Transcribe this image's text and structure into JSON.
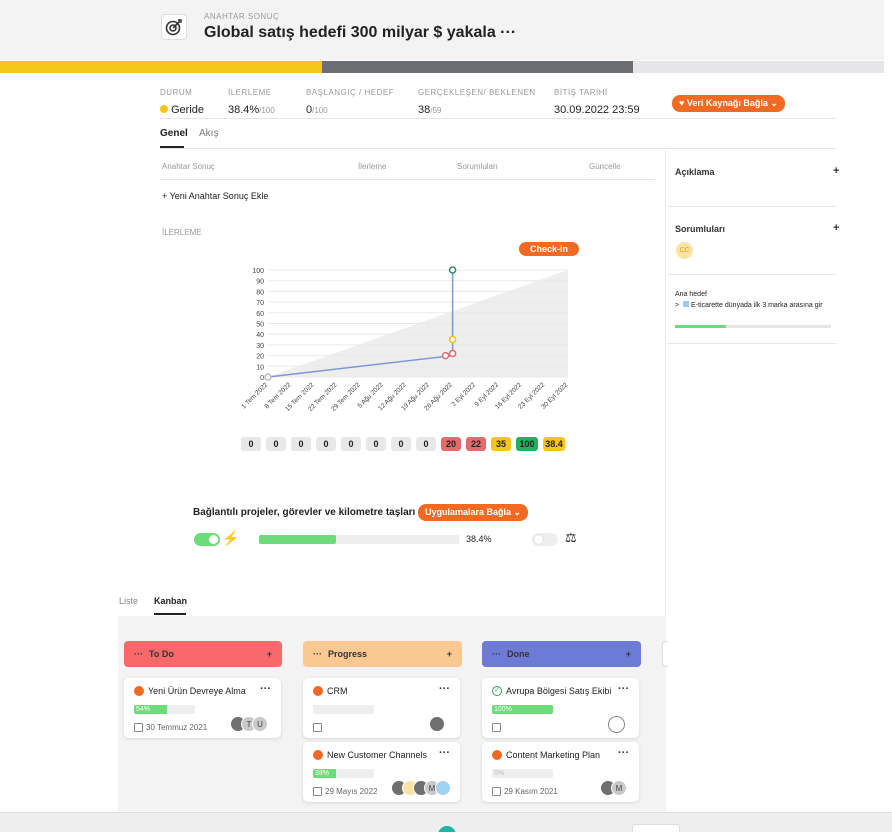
{
  "header": {
    "label": "ANAHTAR SONUÇ",
    "title": "Global satış hedefi 300 milyar $ yakala ···"
  },
  "progress_strip": {
    "colors": [
      "#f5c518",
      "#6b6e75",
      "#e6e6e8"
    ]
  },
  "meta": {
    "durum_label": "DURUM",
    "durum_value": "Geride",
    "ilerleme_label": "İLERLEME",
    "ilerleme_value": "38.4%",
    "ilerleme_total": "/100",
    "baslangic_label": "BAŞLANGIÇ / HEDEF",
    "baslangic_value": "0",
    "baslangic_total": "/100",
    "gerceklesen_label": "GERÇEKLEŞEN/ BEKLENEN",
    "gerceklesen_value": "38",
    "gerceklesen_total": "/59",
    "bitis_label": "BİTİŞ TARİHİ",
    "bitis_value": "30.09.2022 23:59",
    "data_source_button": "♥ Veri Kaynağı Bağla ⌄"
  },
  "tabs": {
    "general": "Genel",
    "flow": "Akış"
  },
  "table": {
    "col_key_result": "Anahtar Sonuç",
    "col_progress": "İlerleme",
    "col_owners": "Sorumluları",
    "col_update": "Güncelle",
    "add_new": "+ Yeni Anahtar Sonuç Ekle"
  },
  "chart_section": {
    "label": "İLERLEME",
    "checkin_button": "Check-in"
  },
  "chart_data": {
    "type": "line",
    "x": [
      "1 Tem 2022",
      "8 Tem 2022",
      "15 Tem 2022",
      "22 Tem 2022",
      "29 Tem 2022",
      "5 Ağu 2022",
      "12 Ağu 2022",
      "19 Ağu 2022",
      "26 Ağu 2022",
      "2 Eyl 2022",
      "9 Eyl 2022",
      "16 Eyl 2022",
      "23 Eyl 2022",
      "30 Eyl 2022"
    ],
    "y_ticks": [
      "0",
      "10",
      "20",
      "30",
      "40",
      "50",
      "60",
      "70",
      "80",
      "90",
      "100"
    ],
    "ylim": [
      0,
      100
    ],
    "series": [
      {
        "values": [
          0,
          null,
          null,
          null,
          null,
          null,
          null,
          null,
          20,
          null,
          null,
          null,
          null,
          null
        ],
        "color": "#7c98d8"
      },
      {
        "values": [
          null,
          null,
          null,
          null,
          null,
          null,
          null,
          null,
          22,
          null,
          null,
          null,
          null,
          null
        ],
        "color": "#e06c6c"
      },
      {
        "values": [
          null,
          null,
          null,
          null,
          null,
          null,
          null,
          null,
          35,
          null,
          null,
          null,
          null,
          null
        ],
        "color": "#f0c419"
      },
      {
        "values": [
          null,
          null,
          null,
          null,
          null,
          null,
          null,
          null,
          100,
          null,
          null,
          null,
          null,
          null
        ],
        "color": "#2e8b57"
      }
    ],
    "expected_area": {
      "from": 0,
      "to": 100,
      "color": "#eeeeee"
    }
  },
  "chips": [
    {
      "text": "0",
      "color": "#e8e8e8"
    },
    {
      "text": "0",
      "color": "#e8e8e8"
    },
    {
      "text": "0",
      "color": "#e8e8e8"
    },
    {
      "text": "0",
      "color": "#e8e8e8"
    },
    {
      "text": "0",
      "color": "#e8e8e8"
    },
    {
      "text": "0",
      "color": "#e8e8e8"
    },
    {
      "text": "0",
      "color": "#e8e8e8"
    },
    {
      "text": "0",
      "color": "#e8e8e8"
    },
    {
      "text": "20",
      "color": "#e06c6c"
    },
    {
      "text": "22",
      "color": "#e06c6c"
    },
    {
      "text": "35",
      "color": "#f5c518"
    },
    {
      "text": "100",
      "color": "#22b060"
    },
    {
      "text": "38.4",
      "color": "#f5c518"
    }
  ],
  "connected": {
    "title": "Bağlantılı projeler, görevler ve kilometre taşları",
    "button": "Uygulamalara Bağla ⌄",
    "progress_text": "38.4%",
    "progress": 0.384
  },
  "sidebar": {
    "description": "Açıklama",
    "owners": "Sorumluları",
    "owner_initials": "CC",
    "parent_label": "Ana hedef",
    "parent_goal": "E-ticarette dünyada ilk 3 marka arasına gir",
    "parent_progress": 0.33
  },
  "view_tabs": {
    "list": "Liste",
    "kanban": "Kanban"
  },
  "kanban": {
    "todo": "To Do",
    "progress": "Progress",
    "done": "Done",
    "cards": {
      "c1": {
        "title": "Yeni Ürün Devreye Alma",
        "pct": "54%",
        "progress": 0.54,
        "date": "30 Temmuz 2021",
        "av2": "T",
        "av3": "U"
      },
      "c2": {
        "title": "CRM"
      },
      "c3": {
        "title": "New Customer Channels",
        "pct": "38%",
        "progress": 0.38,
        "date": "29 Mayıs 2022",
        "av3": "M"
      },
      "c4": {
        "title": "Avrupa Bölgesi Satış Ekibi",
        "pct": "100%",
        "progress": 1.0
      },
      "c5": {
        "title": "Content Marketing Plan",
        "pct": "0%",
        "progress": 0,
        "date": "29 Kasım 2021",
        "av2": "M"
      }
    }
  }
}
